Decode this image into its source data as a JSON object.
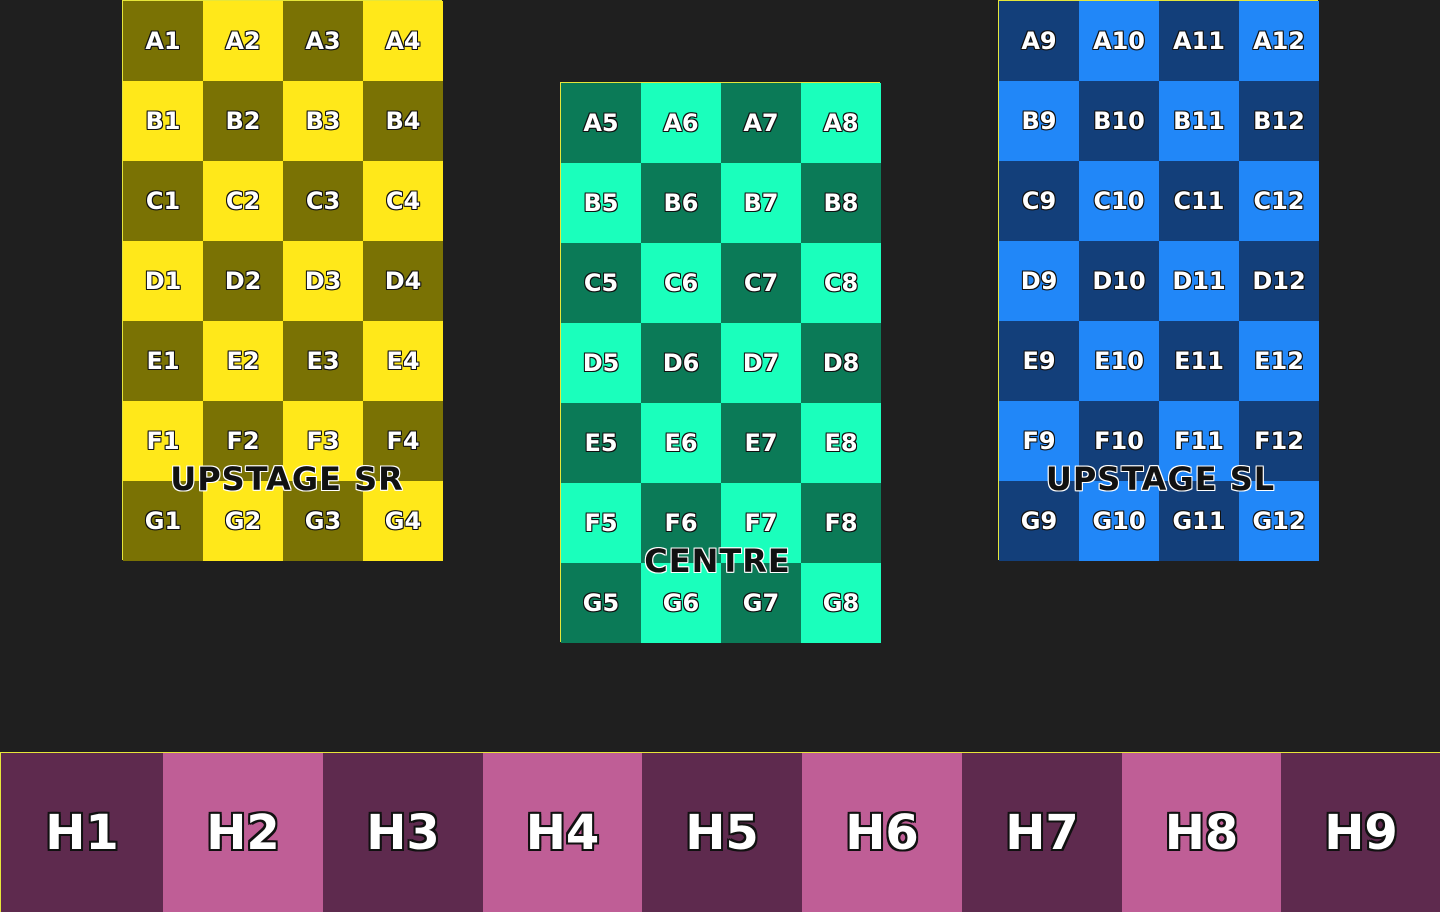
{
  "colors": {
    "background": "#1f1f1f",
    "border": "#e6e63a",
    "sr_dark": "#7a7204",
    "sr_light": "#ffe81a",
    "centre_dark": "#0b7a57",
    "centre_light": "#1affbc",
    "sl_dark": "#133f7a",
    "sl_light": "#2187f8",
    "downstage_dark": "#5e2a4e",
    "downstage_light": "#bf5e96"
  },
  "zones": {
    "sr": {
      "label": "UPSTAGE SR",
      "rows": [
        [
          "A1",
          "A2",
          "A3",
          "A4"
        ],
        [
          "B1",
          "B2",
          "B3",
          "B4"
        ],
        [
          "C1",
          "C2",
          "C3",
          "C4"
        ],
        [
          "D1",
          "D2",
          "D3",
          "D4"
        ],
        [
          "E1",
          "E2",
          "E3",
          "E4"
        ],
        [
          "F1",
          "F2",
          "F3",
          "F4"
        ],
        [
          "G1",
          "G2",
          "G3",
          "G4"
        ]
      ]
    },
    "centre": {
      "label": "CENTRE",
      "rows": [
        [
          "A5",
          "A6",
          "A7",
          "A8"
        ],
        [
          "B5",
          "B6",
          "B7",
          "B8"
        ],
        [
          "C5",
          "C6",
          "C7",
          "C8"
        ],
        [
          "D5",
          "D6",
          "D7",
          "D8"
        ],
        [
          "E5",
          "E6",
          "E7",
          "E8"
        ],
        [
          "F5",
          "F6",
          "F7",
          "F8"
        ],
        [
          "G5",
          "G6",
          "G7",
          "G8"
        ]
      ]
    },
    "sl": {
      "label": "UPSTAGE SL",
      "rows": [
        [
          "A9",
          "A10",
          "A11",
          "A12"
        ],
        [
          "B9",
          "B10",
          "B11",
          "B12"
        ],
        [
          "C9",
          "C10",
          "C11",
          "C12"
        ],
        [
          "D9",
          "D10",
          "D11",
          "D12"
        ],
        [
          "E9",
          "E10",
          "E11",
          "E12"
        ],
        [
          "F9",
          "F10",
          "F11",
          "F12"
        ],
        [
          "G9",
          "G10",
          "G11",
          "G12"
        ]
      ]
    }
  },
  "downstage": {
    "cells": [
      "H1",
      "H2",
      "H3",
      "H4",
      "H5",
      "H6",
      "H7",
      "H8",
      "H9"
    ]
  }
}
